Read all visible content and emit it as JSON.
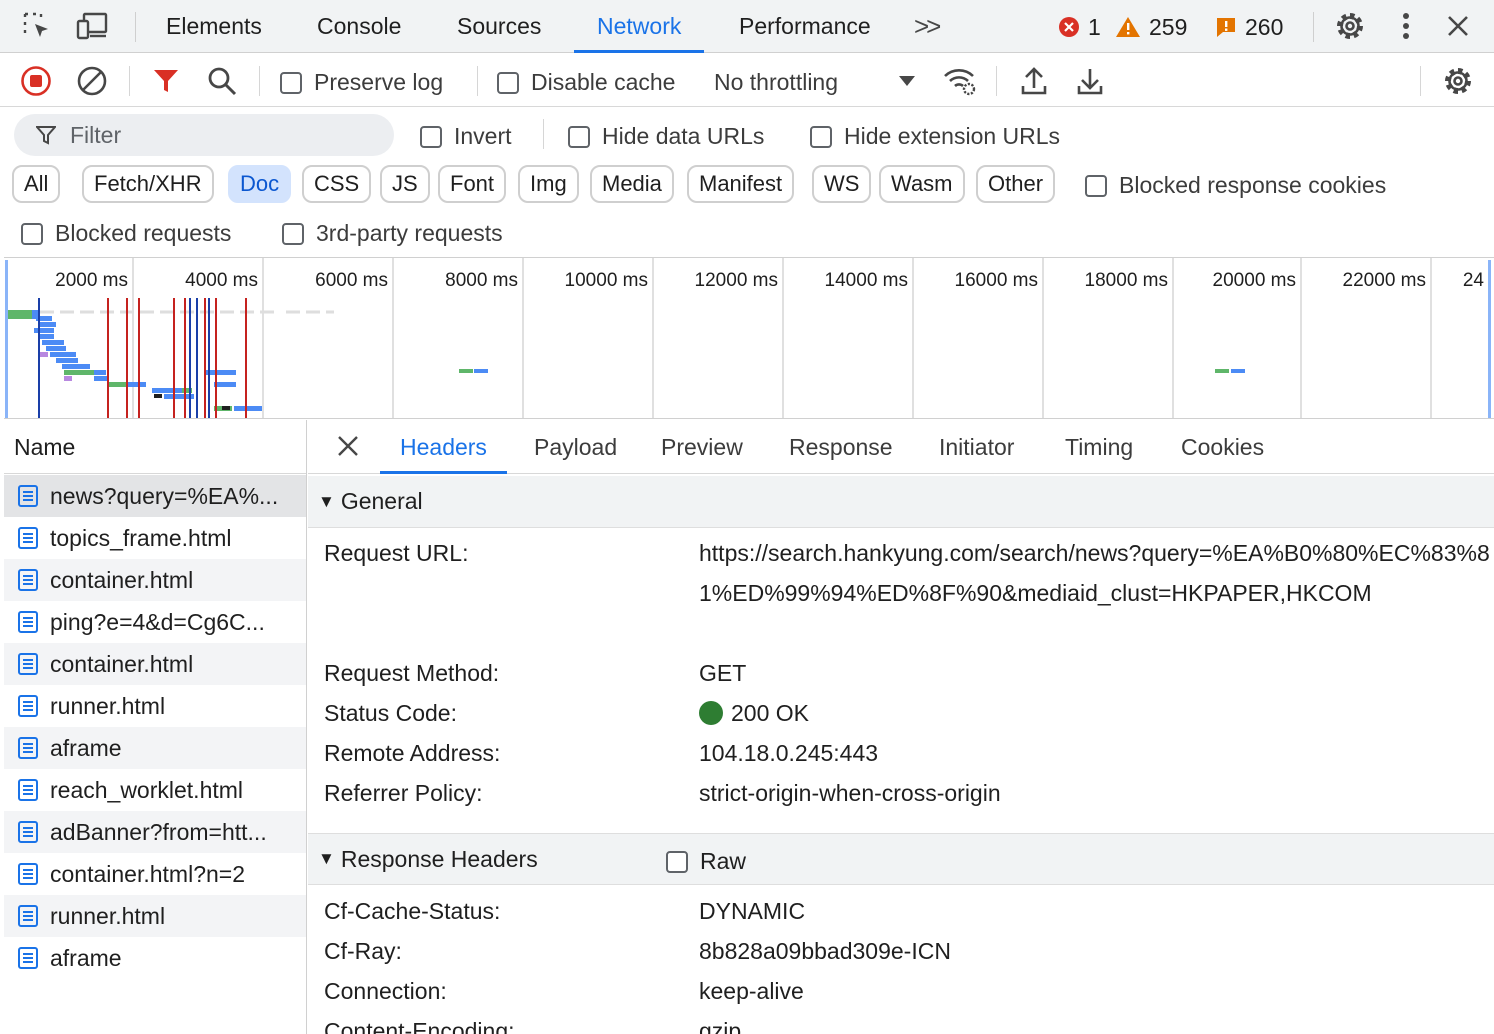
{
  "tabs": {
    "items": [
      "Elements",
      "Console",
      "Sources",
      "Network",
      "Performance"
    ],
    "active": "Network",
    "more": ">>"
  },
  "counters": {
    "errors": "1",
    "warnings": "259",
    "issues": "260"
  },
  "toolbar": {
    "preserve_log": "Preserve log",
    "disable_cache": "Disable cache",
    "throttling": "No throttling"
  },
  "filter": {
    "placeholder": "Filter",
    "invert": "Invert",
    "hide_data_urls": "Hide data URLs",
    "hide_extension_urls": "Hide extension URLs",
    "chips": [
      "All",
      "Fetch/XHR",
      "Doc",
      "CSS",
      "JS",
      "Font",
      "Img",
      "Media",
      "Manifest",
      "WS",
      "Wasm",
      "Other"
    ],
    "active_chip": "Doc",
    "blocked_response_cookies": "Blocked response cookies",
    "blocked_requests": "Blocked requests",
    "third_party": "3rd-party requests"
  },
  "overview": {
    "ticks": [
      "2000 ms",
      "4000 ms",
      "6000 ms",
      "8000 ms",
      "10000 ms",
      "12000 ms",
      "14000 ms",
      "16000 ms",
      "18000 ms",
      "20000 ms",
      "22000 ms",
      "24"
    ]
  },
  "requests": {
    "header": "Name",
    "items": [
      "news?query=%EA%...",
      "topics_frame.html",
      "container.html",
      "ping?e=4&d=Cg6C...",
      "container.html",
      "runner.html",
      "aframe",
      "reach_worklet.html",
      "adBanner?from=htt...",
      "container.html?n=2",
      "runner.html",
      "aframe"
    ]
  },
  "details": {
    "tabs": [
      "Headers",
      "Payload",
      "Preview",
      "Response",
      "Initiator",
      "Timing",
      "Cookies"
    ],
    "active_tab": "Headers",
    "general": {
      "title": "General",
      "request_url_label": "Request URL:",
      "request_url_value": "https://search.hankyung.com/search/news?query=%EA%B0%80%EC%83%81%ED%99%94%ED%8F%90&mediaid_clust=HKPAPER,HKCOM",
      "method_label": "Request Method:",
      "method_value": "GET",
      "status_label": "Status Code:",
      "status_value": "200 OK",
      "remote_label": "Remote Address:",
      "remote_value": "104.18.0.245:443",
      "referrer_label": "Referrer Policy:",
      "referrer_value": "strict-origin-when-cross-origin"
    },
    "response_headers": {
      "title": "Response Headers",
      "raw": "Raw",
      "rows": [
        {
          "k": "Cf-Cache-Status:",
          "v": "DYNAMIC"
        },
        {
          "k": "Cf-Ray:",
          "v": "8b828a09bbad309e-ICN"
        },
        {
          "k": "Connection:",
          "v": "keep-alive"
        },
        {
          "k": "Content-Encoding:",
          "v": "gzip"
        }
      ]
    }
  },
  "colors": {
    "accent": "#1a73e8",
    "record": "#d93025",
    "status_ok": "#2e7d32",
    "warning": "#e37400"
  }
}
